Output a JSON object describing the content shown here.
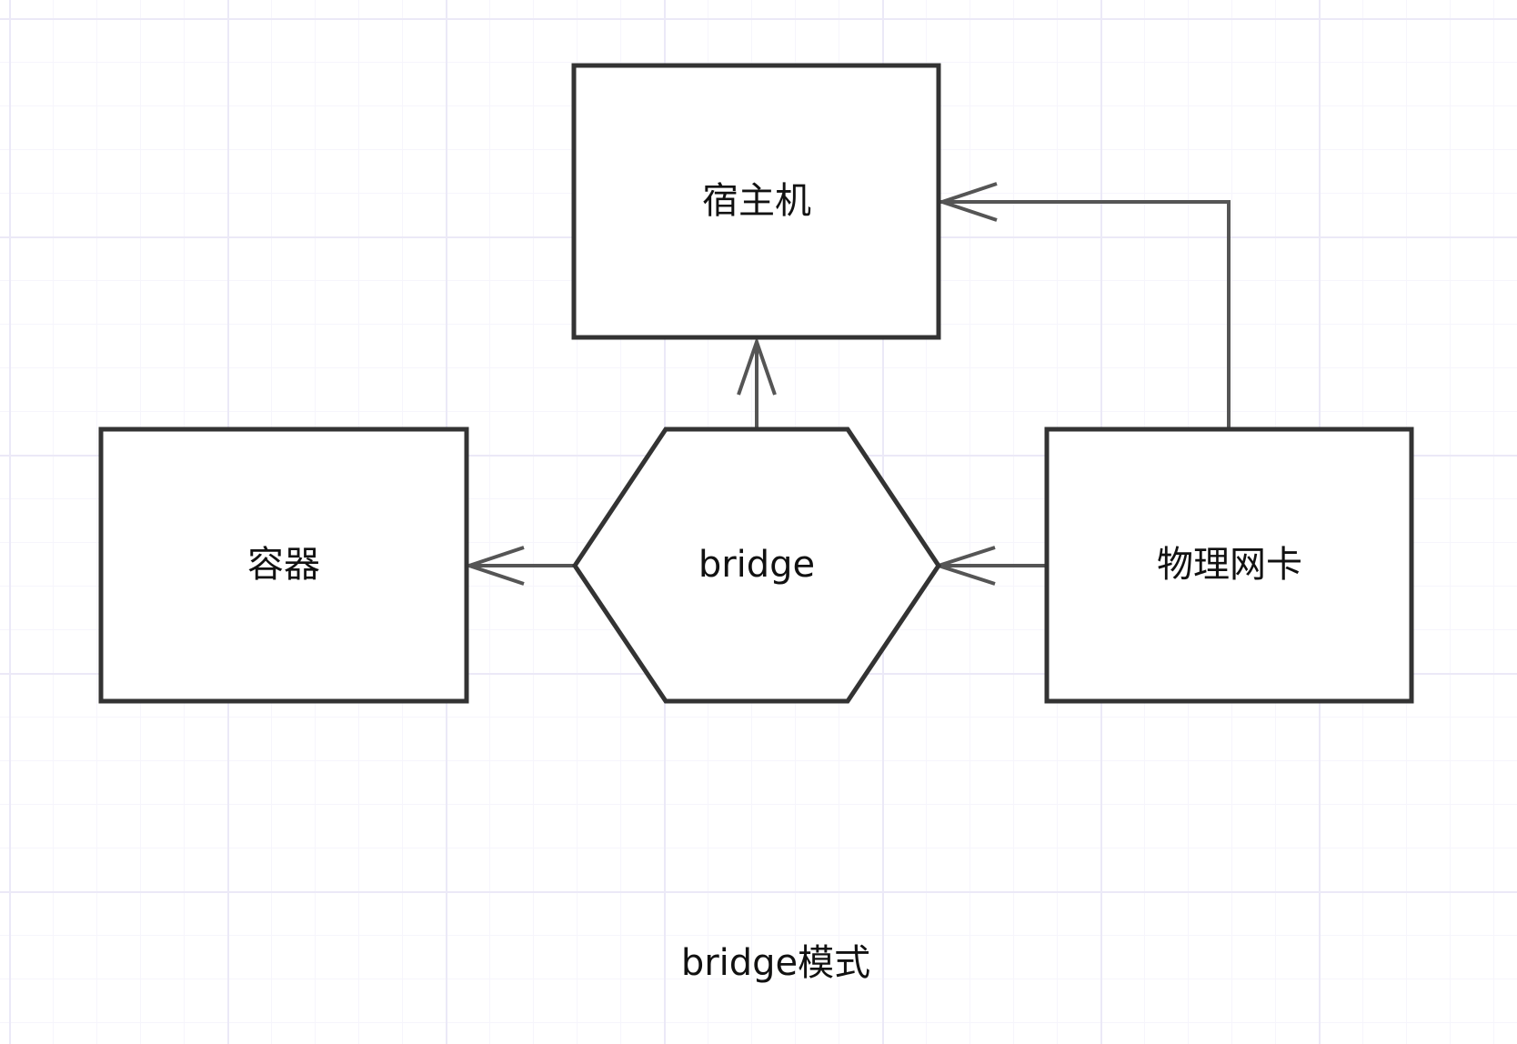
{
  "diagram": {
    "nodes": {
      "host": {
        "label": "宿主机",
        "shape": "rectangle"
      },
      "bridge": {
        "label": "bridge",
        "shape": "hexagon"
      },
      "container": {
        "label": "容器",
        "shape": "rectangle"
      },
      "nic": {
        "label": "物理网卡",
        "shape": "rectangle"
      }
    },
    "edges": [
      {
        "from": "bridge",
        "to": "host",
        "arrowhead": "open"
      },
      {
        "from": "bridge",
        "to": "container",
        "arrowhead": "open"
      },
      {
        "from": "nic",
        "to": "bridge",
        "arrowhead": "open"
      },
      {
        "from": "nic",
        "to": "host",
        "arrowhead": "open"
      }
    ],
    "caption": "bridge模式"
  },
  "colors": {
    "background": "#ffffff",
    "grid_major": "#ebe9f7",
    "grid_minor": "#f6f5fc",
    "stroke": "#333333",
    "edge": "#555555",
    "text": "#111111"
  }
}
